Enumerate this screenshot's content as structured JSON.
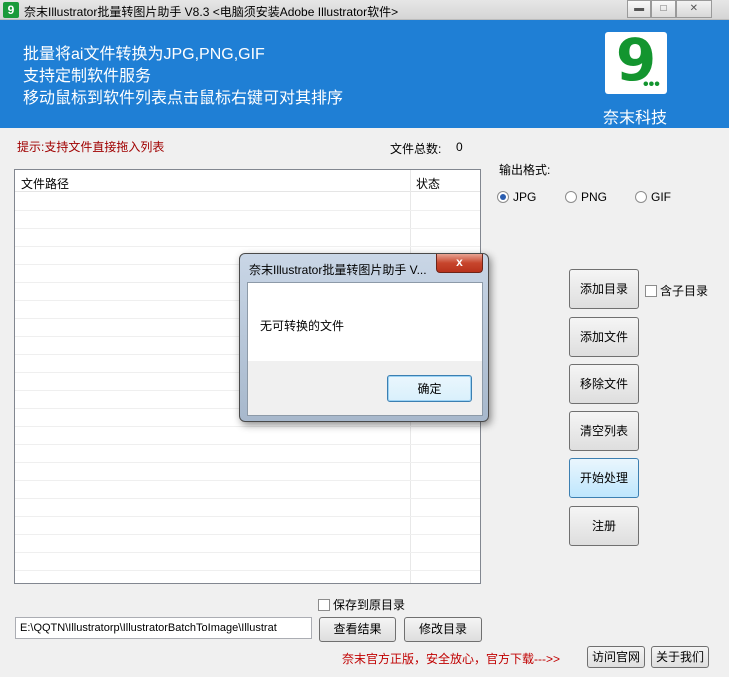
{
  "window": {
    "title": "奈末Illustrator批量转图片助手 V8.3 <电脑须安装Adobe Illustrator软件>",
    "controls": [
      "minimize",
      "maximize",
      "close"
    ]
  },
  "banner": {
    "line1": "批量将ai文件转换为JPG,PNG,GIF",
    "line2": "支持定制软件服务",
    "line3": "移动鼠标到软件列表点击鼠标右键可对其排序",
    "brand_name": "奈末科技",
    "logo_icon": "nm-logo-icon"
  },
  "list": {
    "tip": "提示:支持文件直接拖入列表",
    "count_label": "文件总数:",
    "count_value": "0",
    "columns": [
      "文件路径",
      "状态"
    ]
  },
  "format": {
    "label": "输出格式:",
    "options": [
      "JPG",
      "PNG",
      "GIF"
    ],
    "selected": "JPG"
  },
  "actions": {
    "add_dir": "添加目录",
    "include_subdir": "含子目录",
    "add_file": "添加文件",
    "remove_file": "移除文件",
    "clear_list": "清空列表",
    "start": "开始处理",
    "register": "注册"
  },
  "bottom": {
    "save_to_original": "保存到原目录",
    "output_path": "E:\\QQTN\\Illustratorp\\IllustratorBatchToImage\\Illustrat",
    "view_result": "查看结果",
    "change_dir": "修改目录",
    "promo": "奈末官方正版，安全放心，官方下载--->>",
    "visit_site": "访问官网",
    "about": "关于我们"
  },
  "dialog": {
    "title": "奈末Illustrator批量转图片助手 V...",
    "message": "无可转换的文件",
    "ok": "确定",
    "close_glyph": "x"
  },
  "colors": {
    "banner": "#1f7fd5",
    "brand_green": "#13952f",
    "tip_red": "#a00000",
    "promo_red": "#c00000"
  }
}
